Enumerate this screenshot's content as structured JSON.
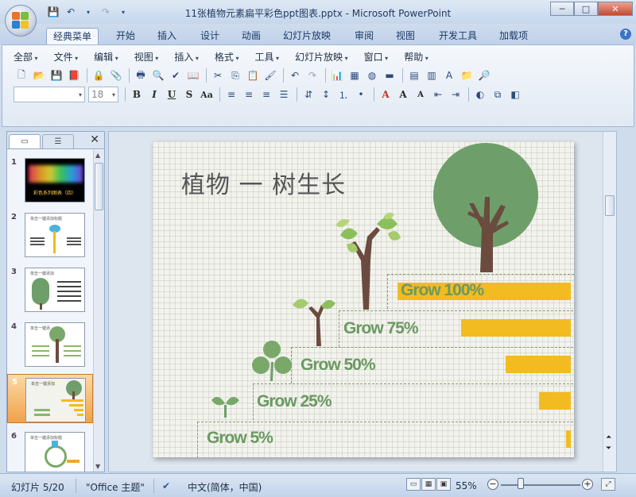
{
  "window": {
    "title": "11张植物元素扁平彩色ppt图表.pptx - Microsoft PowerPoint"
  },
  "tabs": [
    "经典菜单",
    "开始",
    "插入",
    "设计",
    "动画",
    "幻灯片放映",
    "审阅",
    "视图",
    "开发工具",
    "加载项"
  ],
  "active_tab": "经典菜单",
  "menu": [
    "全部",
    "文件",
    "编辑",
    "视图",
    "插入",
    "格式",
    "工具",
    "幻灯片放映",
    "窗口",
    "帮助"
  ],
  "font_size_value": "18",
  "slides_pane": {
    "thumbnails": [
      {
        "number": "1",
        "caption": "彩色系列图表（四）"
      },
      {
        "number": "2",
        "caption": "单击一键添加标题"
      },
      {
        "number": "3",
        "caption": "单击一键添加"
      },
      {
        "number": "4",
        "caption": "单击一键添"
      },
      {
        "number": "5",
        "caption": "单击一键添加"
      },
      {
        "number": "6",
        "caption": "单击一键添加标题"
      }
    ],
    "selected": "5"
  },
  "slide": {
    "title": "植物 一 树生长",
    "rows": [
      {
        "label": "Grow 100%",
        "percent": 100
      },
      {
        "label": "Grow 75%",
        "percent": 75
      },
      {
        "label": "Grow 50%",
        "percent": 50
      },
      {
        "label": "Grow 25%",
        "percent": 25
      },
      {
        "label": "Grow 5%",
        "percent": 5
      }
    ],
    "colors": {
      "bar": "#f2bb1f",
      "label": "#6a9a61",
      "leaf": "#79a869",
      "trunk": "#6b4b3e",
      "canopy": "#6e9f6a"
    }
  },
  "status": {
    "slide_info": "幻灯片 5/20",
    "theme": "\"Office 主题\"",
    "language": "中文(简体，中国)",
    "zoom": "55%"
  }
}
